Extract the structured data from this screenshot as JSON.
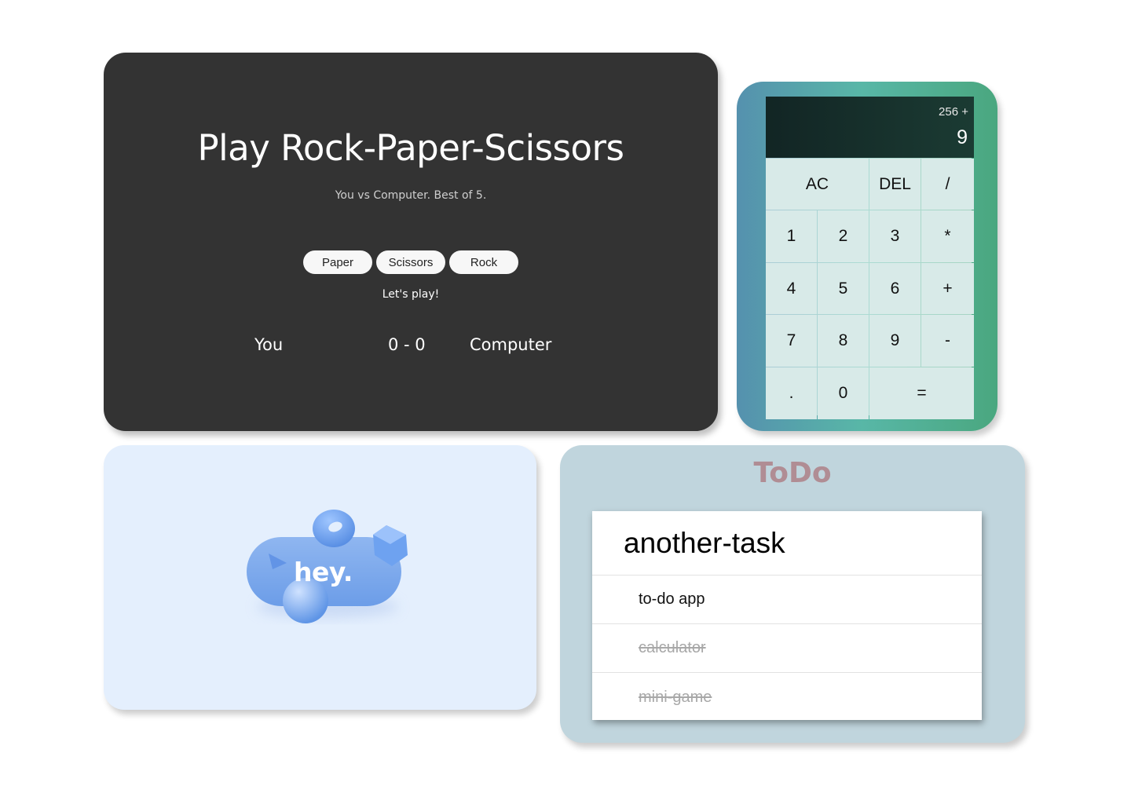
{
  "rps": {
    "title": "Play Rock-Paper-Scissors",
    "subtitle": "You vs Computer. Best of 5.",
    "buttons": [
      "Paper",
      "Scissors",
      "Rock"
    ],
    "status": "Let's play!",
    "player_label": "You",
    "score": "0 - 0",
    "computer_label": "Computer"
  },
  "calculator": {
    "previous": "256 +",
    "current": "9",
    "keys": {
      "ac": "AC",
      "del": "DEL",
      "divide": "/",
      "one": "1",
      "two": "2",
      "three": "3",
      "multiply": "*",
      "four": "4",
      "five": "5",
      "six": "6",
      "plus": "+",
      "seven": "7",
      "eight": "8",
      "nine": "9",
      "minus": "-",
      "dot": ".",
      "zero": "0",
      "equals": "="
    }
  },
  "hey": {
    "label": "hey."
  },
  "todo": {
    "title": "ToDo",
    "input_value": "another-task",
    "items": [
      {
        "text": "to-do app",
        "done": false
      },
      {
        "text": "calculator",
        "done": true
      },
      {
        "text": "mini-game",
        "done": true
      }
    ]
  },
  "colors": {
    "rps_bg": "#333333",
    "calc_gradient": [
      "#5591ae",
      "#58b7a7",
      "#4aa77f"
    ],
    "hey_bg": "#e4effd",
    "todo_bg": "#c0d5dd",
    "todo_title": "#b08d94"
  }
}
